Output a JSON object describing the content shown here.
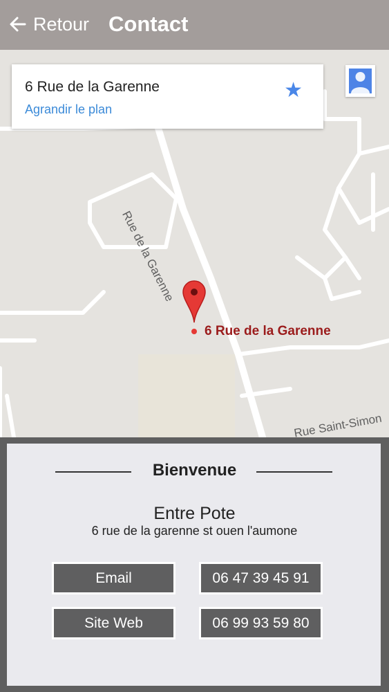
{
  "header": {
    "back_label": "Retour",
    "title": "Contact"
  },
  "map": {
    "card": {
      "title": "6 Rue de la Garenne",
      "link": "Agrandir le plan"
    },
    "street_labels": [
      "Rue de la Garenne",
      "Rue Saint-Simon"
    ],
    "marker_label": "6 Rue de la Garenne",
    "icons": [
      "back-arrow-icon",
      "star-icon",
      "person-icon",
      "map-marker-icon"
    ]
  },
  "panel": {
    "heading": "Bienvenue",
    "business_name": "Entre Pote",
    "address": "6 rue de la garenne st ouen l'aumone",
    "buttons": {
      "email": "Email",
      "phone1": "06 47 39 45 91",
      "website": "Site Web",
      "phone2": "06 99 93 59 80"
    }
  },
  "colors": {
    "header_bg": "#a39d9b",
    "button_bg": "#5f5f60",
    "panel_bg": "#eaeaee",
    "link": "#3b8ad8",
    "star": "#4a87e8",
    "marker": "#e53935",
    "marker_label": "#9b1c1c"
  }
}
